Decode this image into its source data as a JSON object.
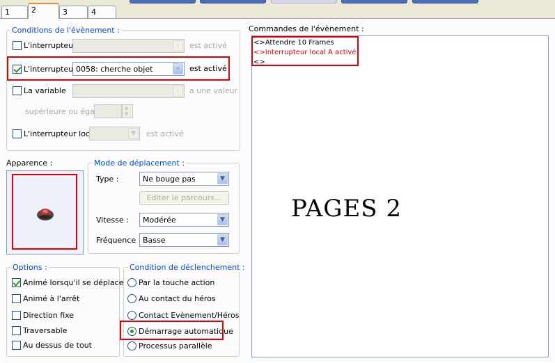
{
  "tabs": [
    "1",
    "2",
    "3",
    "4"
  ],
  "active_tab": "2",
  "conditions": {
    "title": "Conditions de l'évènement :",
    "switch1": {
      "label": "L'interrupteur",
      "value": "",
      "suffix": "est activé",
      "checked": false
    },
    "switch2": {
      "label": "L'interrupteur",
      "value": "0058: cherche objet",
      "suffix": "est activé",
      "checked": true
    },
    "variable": {
      "label": "La variable",
      "value": "",
      "suffix": "a une valeur",
      "checked": false
    },
    "compare_label": "supérieure ou égale",
    "local_switch": {
      "label": "L'interrupteur local",
      "value": "",
      "suffix": "est activé",
      "checked": false
    }
  },
  "appearance": {
    "title": "Apparence :"
  },
  "movement": {
    "title": "Mode de déplacement :",
    "type_label": "Type :",
    "type_value": "Ne bouge pas",
    "route_button": "Editer le parcours...",
    "speed_label": "Vitesse :",
    "speed_value": "Modérée",
    "freq_label": "Fréquence :",
    "freq_value": "Basse"
  },
  "options": {
    "title": "Options :",
    "items": [
      {
        "label": "Animé lorsqu'il se déplace",
        "checked": true
      },
      {
        "label": "Animé à l'arrêt",
        "checked": false
      },
      {
        "label": "Direction fixe",
        "checked": false
      },
      {
        "label": "Traversable",
        "checked": false
      },
      {
        "label": "Au dessus de tout",
        "checked": false
      }
    ]
  },
  "trigger": {
    "title": "Condition de déclenchement :",
    "items": [
      {
        "label": "Par la touche action",
        "selected": false
      },
      {
        "label": "Au contact du héros",
        "selected": false
      },
      {
        "label": "Contact Evènement/Héros",
        "selected": false
      },
      {
        "label": "Démarrage automatique",
        "selected": true
      },
      {
        "label": "Processus parallèle",
        "selected": false
      }
    ]
  },
  "commands": {
    "title": "Commandes de l'évènement :",
    "lines": [
      {
        "text": "<>Attendre 10 Frames",
        "color": "#000000"
      },
      {
        "text": "<>Interrupteur local A activé",
        "color": "#e00000"
      },
      {
        "text": "<>",
        "color": "#000000"
      }
    ]
  },
  "overlay_text": "PAGES 2",
  "colors": {
    "highlight": "#e00000",
    "legend": "#0046d5"
  }
}
